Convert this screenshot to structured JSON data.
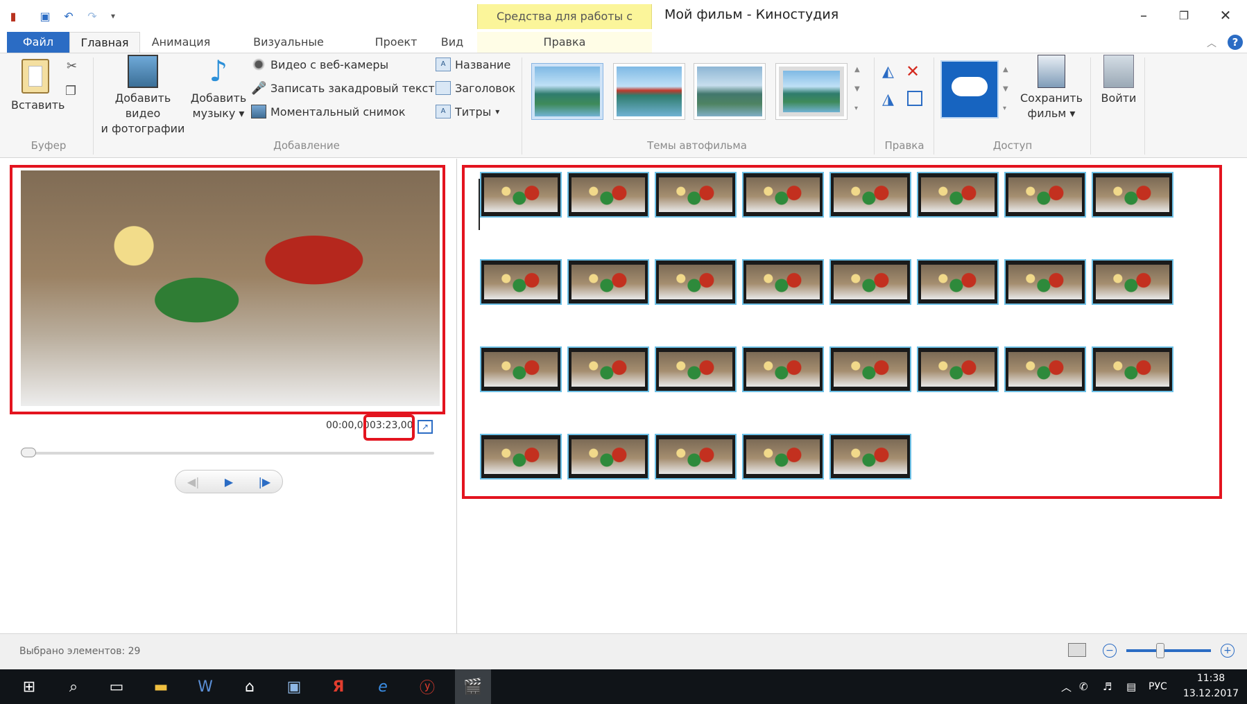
{
  "titlebar": {
    "contextual_tab_group": "Средства для работы с видео",
    "window_title": "Мой фильм - Киностудия"
  },
  "tabs": {
    "file": "Файл",
    "home": "Главная",
    "animation": "Анимация",
    "visual_effects": "Визуальные эффекты",
    "project": "Проект",
    "view": "Вид",
    "edit": "Правка"
  },
  "ribbon": {
    "clipboard": {
      "paste": "Вставить",
      "group": "Буфер"
    },
    "add": {
      "add_video_line1": "Добавить видео",
      "add_video_line2": "и фотографии",
      "add_music_line1": "Добавить",
      "add_music_line2": "музыку",
      "webcam": "Видео с веб-камеры",
      "narration": "Записать закадровый текст",
      "snapshot": "Моментальный снимок",
      "title": "Название",
      "caption": "Заголовок",
      "credits": "Титры",
      "group": "Добавление"
    },
    "themes": {
      "group": "Темы автофильма"
    },
    "editing": {
      "group": "Правка"
    },
    "share": {
      "save_line1": "Сохранить",
      "save_line2": "фильм",
      "group": "Доступ"
    },
    "signin": "Войти"
  },
  "player": {
    "current_time": "00:00,00",
    "total_time": "03:23,00",
    "progress": 0
  },
  "storyboard": {
    "rows": [
      8,
      8,
      8,
      5
    ]
  },
  "status": {
    "selected": "Выбрано элементов: 29",
    "zoom_level": 0.4
  },
  "taskbar": {
    "language": "РУС",
    "time": "11:38",
    "date": "13.12.2017"
  },
  "colors": {
    "accent": "#2b6cc4",
    "highlight_box": "#e3141f",
    "context_tab": "#fbf59a",
    "clip_border": "#6cc0e6"
  }
}
